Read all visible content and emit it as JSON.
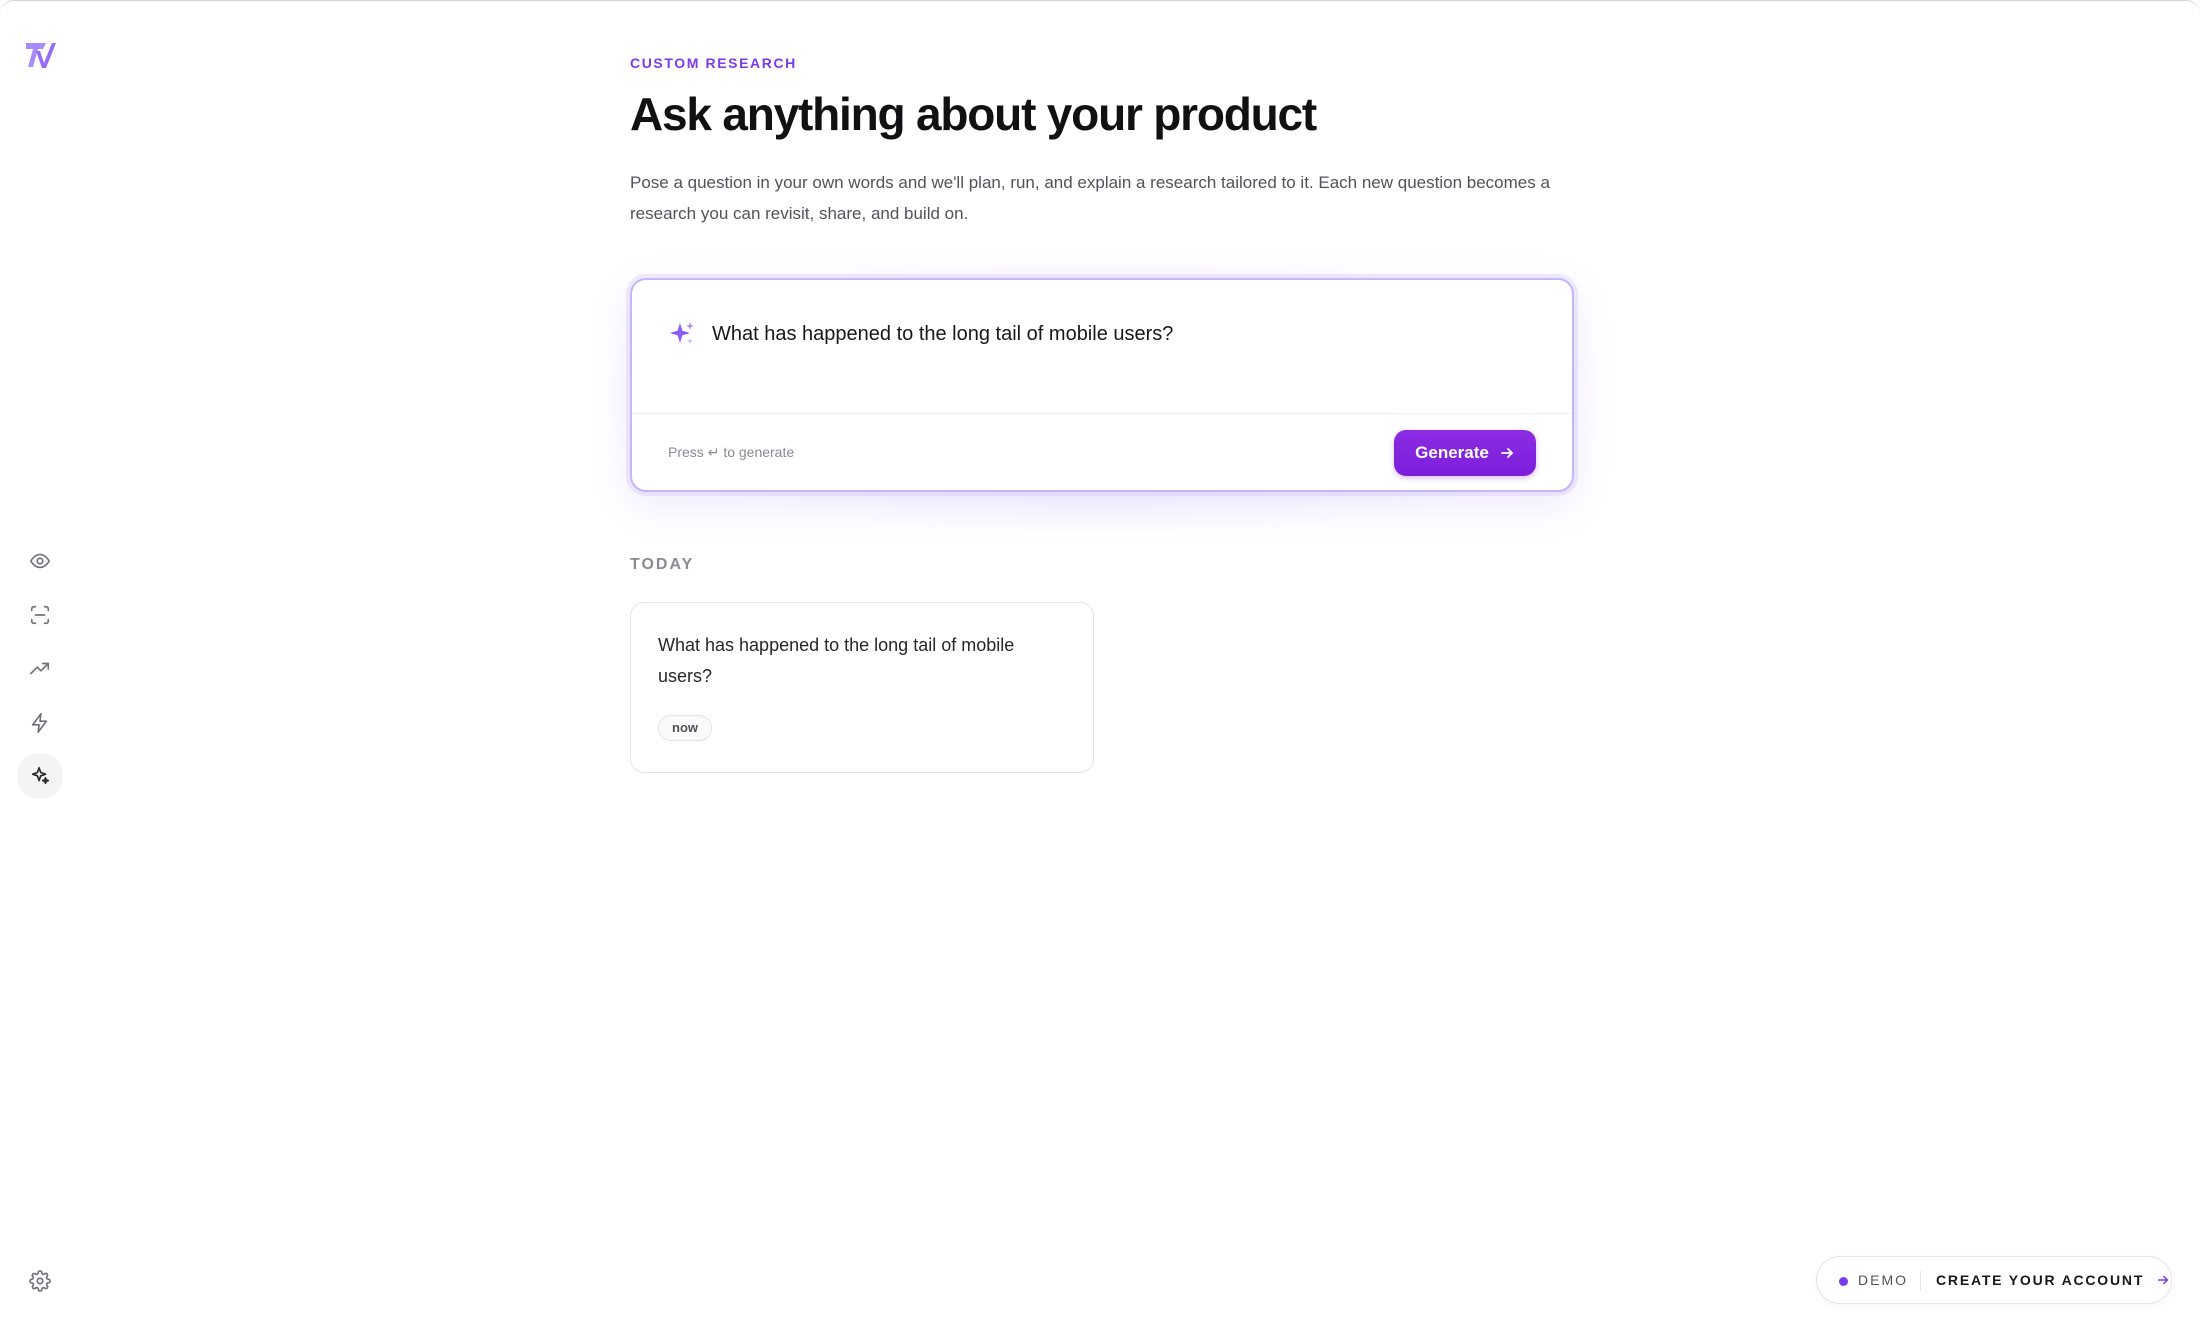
{
  "sidebar": {
    "logo": "tv-logo",
    "items": [
      {
        "icon": "eye-icon",
        "active": false
      },
      {
        "icon": "scan-icon",
        "active": false
      },
      {
        "icon": "trending-up-icon",
        "active": false
      },
      {
        "icon": "lightning-icon",
        "active": false
      },
      {
        "icon": "sparkles-icon",
        "active": true
      }
    ],
    "settings_icon": "gear-icon"
  },
  "main": {
    "eyebrow": "CUSTOM RESEARCH",
    "title": "Ask anything about your product",
    "subtitle": "Pose a question in your own words and we'll plan, run, and explain a research tailored to it. Each new question becomes a research you can revisit, share, and build on."
  },
  "prompt": {
    "value": "What has happened to the long tail of mobile users?",
    "hint_prefix": "Press",
    "hint_key": "↵",
    "hint_suffix": "to generate",
    "generate_label": "Generate"
  },
  "history": {
    "section_label": "TODAY",
    "items": [
      {
        "title": "What has happened to the long tail of mobile users?",
        "time": "now"
      }
    ]
  },
  "demo_bar": {
    "label": "DEMO",
    "cta": "CREATE YOUR ACCOUNT"
  },
  "colors": {
    "accent": "#7c3aed",
    "button": "#7c1fdc",
    "logo": "#a78bfa"
  }
}
